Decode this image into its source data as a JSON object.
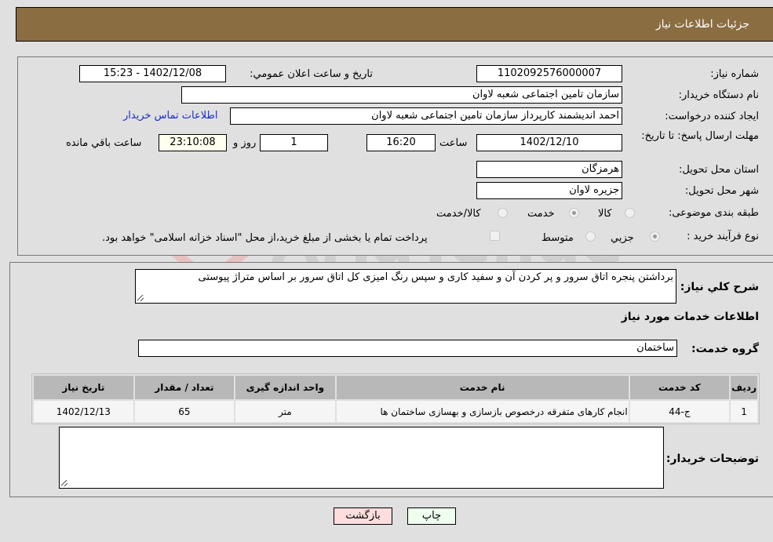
{
  "header": {
    "title": "جزئیات اطلاعات نیاز"
  },
  "details": {
    "need_number": {
      "label": "شماره نیاز:",
      "value": "1102092576000007"
    },
    "announce_datetime": {
      "label": "تاريخ و ساعت اعلان عمومي:",
      "value": "1402/12/08 - 15:23"
    },
    "buyer_org": {
      "label": "نام دستگاه خريدار:",
      "value": "سازمان تامین اجتماعی شعبه لاوان"
    },
    "requester": {
      "label": "ايجاد کننده درخواست:",
      "value": "احمد اندیشمند کارپرداز سازمان تامین اجتماعی شعبه لاوان"
    },
    "buyer_contact_link": "اطلاعات تماس خريدار",
    "deadline": {
      "label": "مهلت ارسال پاسخ: تا تاریخ:",
      "date": "1402/12/10",
      "time_label": "ساعت",
      "time": "16:20",
      "days": "1",
      "days_label": "روز و",
      "remaining": "23:10:08",
      "remaining_label": "ساعت باقي مانده"
    },
    "province": {
      "label": "استان محل تحويل:",
      "value": "هرمزگان"
    },
    "city": {
      "label": "شهر محل تحويل:",
      "value": "جزیره لاوان"
    },
    "category": {
      "label": "طبقه بندی موضوعی:",
      "options": [
        "کالا",
        "خدمت",
        "کالا/خدمت"
      ],
      "selected": "خدمت"
    },
    "purchase_process": {
      "label": "نوع فرآیند خرید :",
      "options": [
        "جزيي",
        "متوسط"
      ],
      "selected": "جزيي",
      "treasury_note": "پرداخت تمام یا بخشی از مبلغ خرید،از محل \"اسناد خزانه اسلامی\" خواهد بود.",
      "treasury_checked": false
    }
  },
  "description": {
    "label": "شرح کلي نياز:",
    "value": "برداشتن پنجره اتاق سرور و پر کردن آن و سفید کاری و سپس رنگ امیزی کل اتاق سرور بر اساس متراژ پیوستی"
  },
  "services": {
    "section_title": "اطلاعات خدمات مورد نياز",
    "group_label": "گروه خدمت:",
    "group_value": "ساختمان",
    "columns": [
      "رديف",
      "کد خدمت",
      "نام خدمت",
      "واحد اندازه گيری",
      "تعداد / مقدار",
      "تاريخ نياز"
    ],
    "rows": [
      [
        "1",
        "ج-44",
        "انجام کارهای متفرقه درخصوص بازسازی و بهسازی ساختمان ها",
        "متر",
        "65",
        "1402/12/13"
      ]
    ]
  },
  "buyer_notes": {
    "label": "توضيحات خريدار:",
    "value": ""
  },
  "buttons": {
    "print": "چاپ",
    "back": "بازگشت"
  },
  "watermark": "AriaTender.neT",
  "colors": {
    "header": "#8b6d42",
    "print_btn": "#eeffee",
    "back_btn": "#ffdddd",
    "link": "#1a2bcc"
  }
}
